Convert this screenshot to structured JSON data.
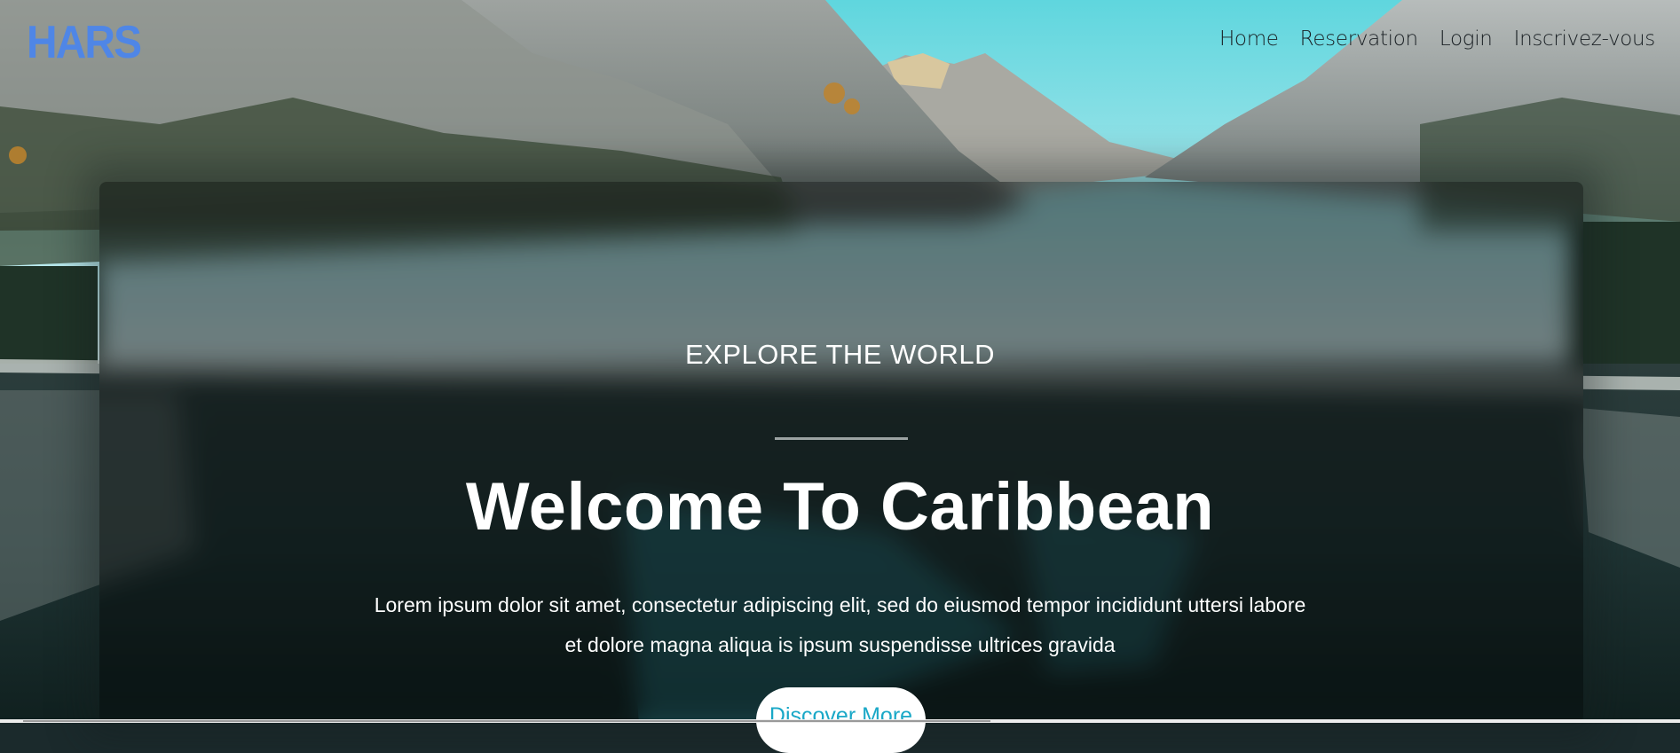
{
  "header": {
    "logo_text": "HARS",
    "nav": [
      {
        "label": "Home"
      },
      {
        "label": "Reservation"
      },
      {
        "label": "Login"
      },
      {
        "label": "Inscrivez-vous"
      }
    ]
  },
  "hero": {
    "eyebrow": "EXPLORE THE WORLD",
    "headline": "Welcome To Caribbean",
    "paragraph_line1": "Lorem ipsum dolor sit amet, consectetur adipiscing elit, sed do eiusmod tempor incididunt uttersi labore",
    "paragraph_line2": "et dolore magna aliqua is ipsum suspendisse ultrices gravida",
    "cta_label": "Discover More"
  },
  "colors": {
    "logo": "#4f86e6",
    "cta_text": "#1aa8c7",
    "cta_bg": "#ffffff"
  }
}
